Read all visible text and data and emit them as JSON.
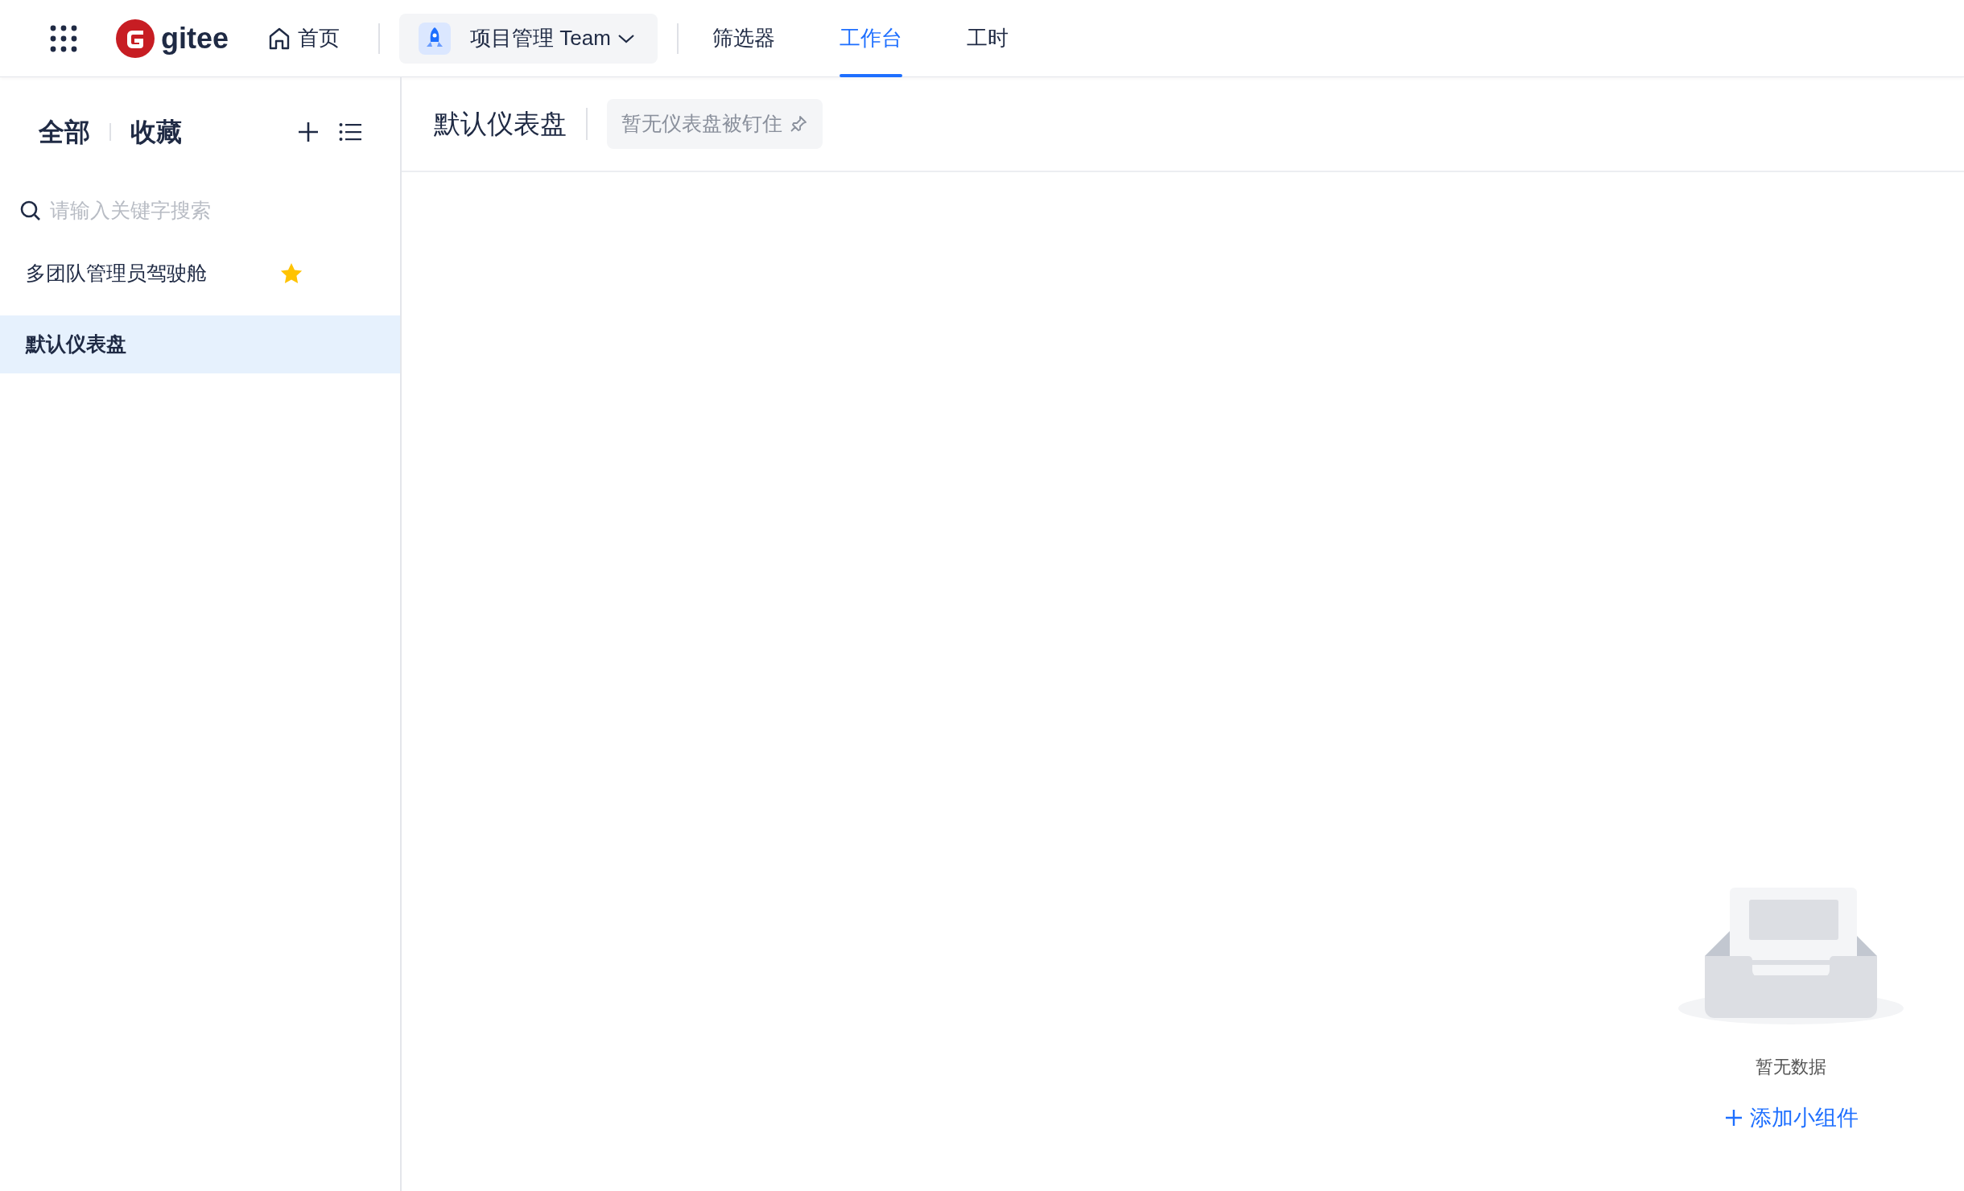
{
  "top_nav": {
    "logo": "gitee",
    "home": "首页",
    "team": "项目管理 Team",
    "tabs": [
      {
        "label": "筛选器",
        "selected": false
      },
      {
        "label": "工作台",
        "selected": true
      },
      {
        "label": "工时",
        "selected": false
      }
    ]
  },
  "sidebar": {
    "filters": [
      "全部",
      "收藏"
    ],
    "search": {
      "placeholder": "请输入关键字搜索"
    },
    "items": [
      {
        "label": "多团队管理员驾驶舱",
        "starred": true,
        "selected": false
      },
      {
        "label": "默认仪表盘",
        "starred": false,
        "selected": true
      }
    ]
  },
  "main": {
    "title": "默认仪表盘",
    "pin_status": "暂无仪表盘被钉住",
    "empty": {
      "message": "暂无数据",
      "action": "添加小组件"
    }
  }
}
